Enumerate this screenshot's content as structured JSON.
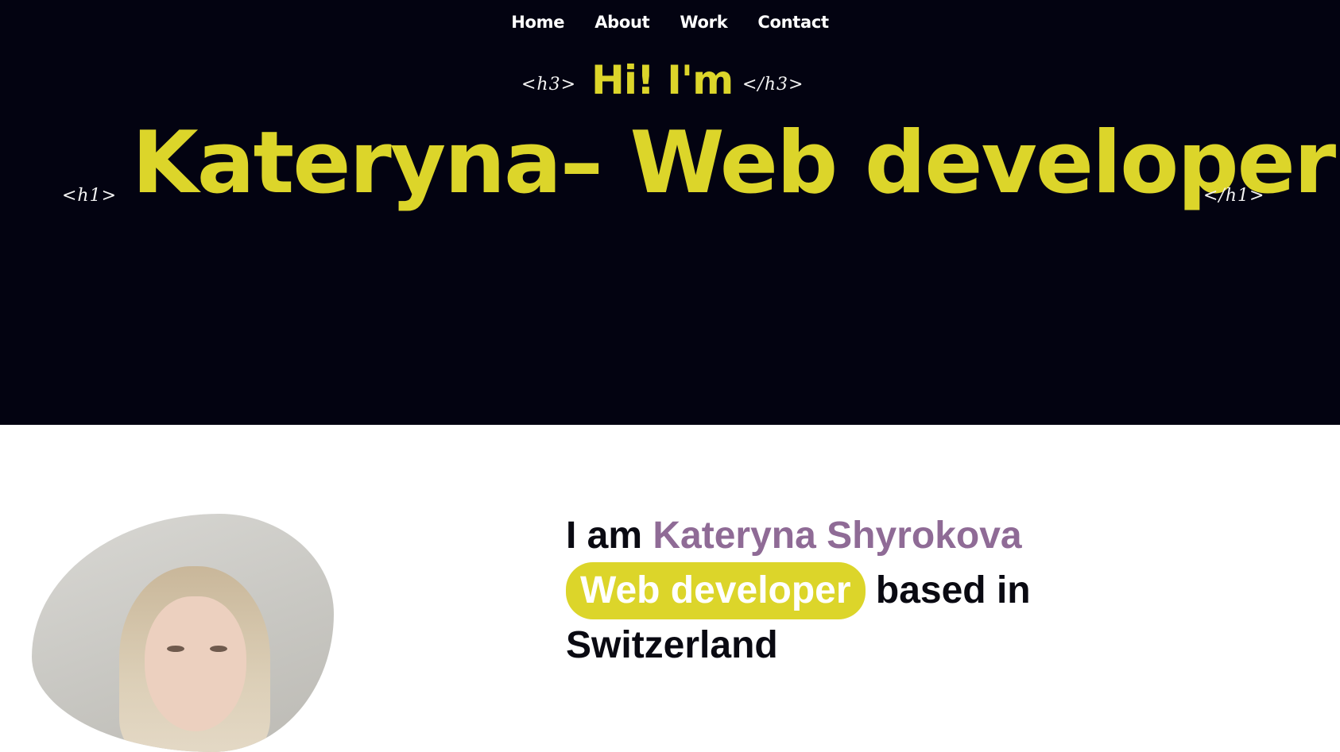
{
  "nav": {
    "items": [
      "Home",
      "About",
      "Work",
      "Contact"
    ]
  },
  "hero": {
    "h3_open": "<h3>",
    "h3_text": "Hi! I'm",
    "h3_close": "</h3>",
    "h1_open": "<h1>",
    "h1_text": "Kateryna– Web developer",
    "h1_close": "</h1>"
  },
  "about": {
    "photo_alt": "Portrait of Kateryna",
    "prefix": "I am",
    "name": "Kateryna Shyrokova",
    "role": "Web developer",
    "suffix": "based in",
    "location": "Switzerland"
  },
  "colors": {
    "hero_bg": "#030311",
    "accent_yellow": "#dcd52a",
    "accent_purple": "#8f6b96",
    "text_dark": "#0a0a12"
  }
}
